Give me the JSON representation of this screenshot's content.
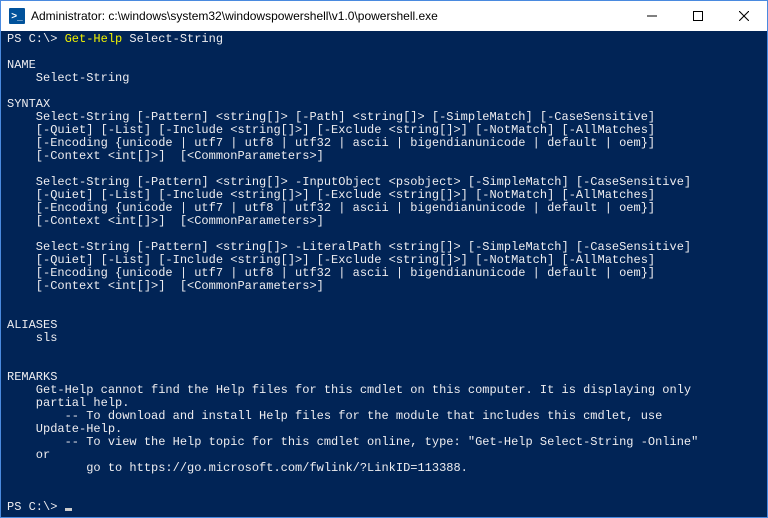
{
  "titlebar": {
    "icon_glyph": ">_",
    "title": "Administrator: c:\\windows\\system32\\windowspowershell\\v1.0\\powershell.exe"
  },
  "terminal": {
    "prompt1_prefix": "PS C:\\> ",
    "prompt1_cmd": "Get-Help",
    "prompt1_arg": " Select-String",
    "section_name_header": "NAME",
    "section_name_value": "    Select-String",
    "section_syntax_header": "SYNTAX",
    "syntax_block1_l1": "    Select-String [-Pattern] <string[]> [-Path] <string[]> [-SimpleMatch] [-CaseSensitive]",
    "syntax_block1_l2": "    [-Quiet] [-List] [-Include <string[]>] [-Exclude <string[]>] [-NotMatch] [-AllMatches]",
    "syntax_block1_l3": "    [-Encoding {unicode | utf7 | utf8 | utf32 | ascii | bigendianunicode | default | oem}]",
    "syntax_block1_l4": "    [-Context <int[]>]  [<CommonParameters>]",
    "syntax_block2_l1": "    Select-String [-Pattern] <string[]> -InputObject <psobject> [-SimpleMatch] [-CaseSensitive]",
    "syntax_block2_l2": "    [-Quiet] [-List] [-Include <string[]>] [-Exclude <string[]>] [-NotMatch] [-AllMatches]",
    "syntax_block2_l3": "    [-Encoding {unicode | utf7 | utf8 | utf32 | ascii | bigendianunicode | default | oem}]",
    "syntax_block2_l4": "    [-Context <int[]>]  [<CommonParameters>]",
    "syntax_block3_l1": "    Select-String [-Pattern] <string[]> -LiteralPath <string[]> [-SimpleMatch] [-CaseSensitive]",
    "syntax_block3_l2": "    [-Quiet] [-List] [-Include <string[]>] [-Exclude <string[]>] [-NotMatch] [-AllMatches]",
    "syntax_block3_l3": "    [-Encoding {unicode | utf7 | utf8 | utf32 | ascii | bigendianunicode | default | oem}]",
    "syntax_block3_l4": "    [-Context <int[]>]  [<CommonParameters>]",
    "section_aliases_header": "ALIASES",
    "section_aliases_value": "    sls",
    "section_remarks_header": "REMARKS",
    "remarks_l1": "    Get-Help cannot find the Help files for this cmdlet on this computer. It is displaying only",
    "remarks_l2": "    partial help.",
    "remarks_l3": "        -- To download and install Help files for the module that includes this cmdlet, use",
    "remarks_l4": "    Update-Help.",
    "remarks_l5": "        -- To view the Help topic for this cmdlet online, type: \"Get-Help Select-String -Online\"",
    "remarks_l6": "    or",
    "remarks_l7": "           go to https://go.microsoft.com/fwlink/?LinkID=113388.",
    "prompt2_prefix": "PS C:\\> "
  }
}
